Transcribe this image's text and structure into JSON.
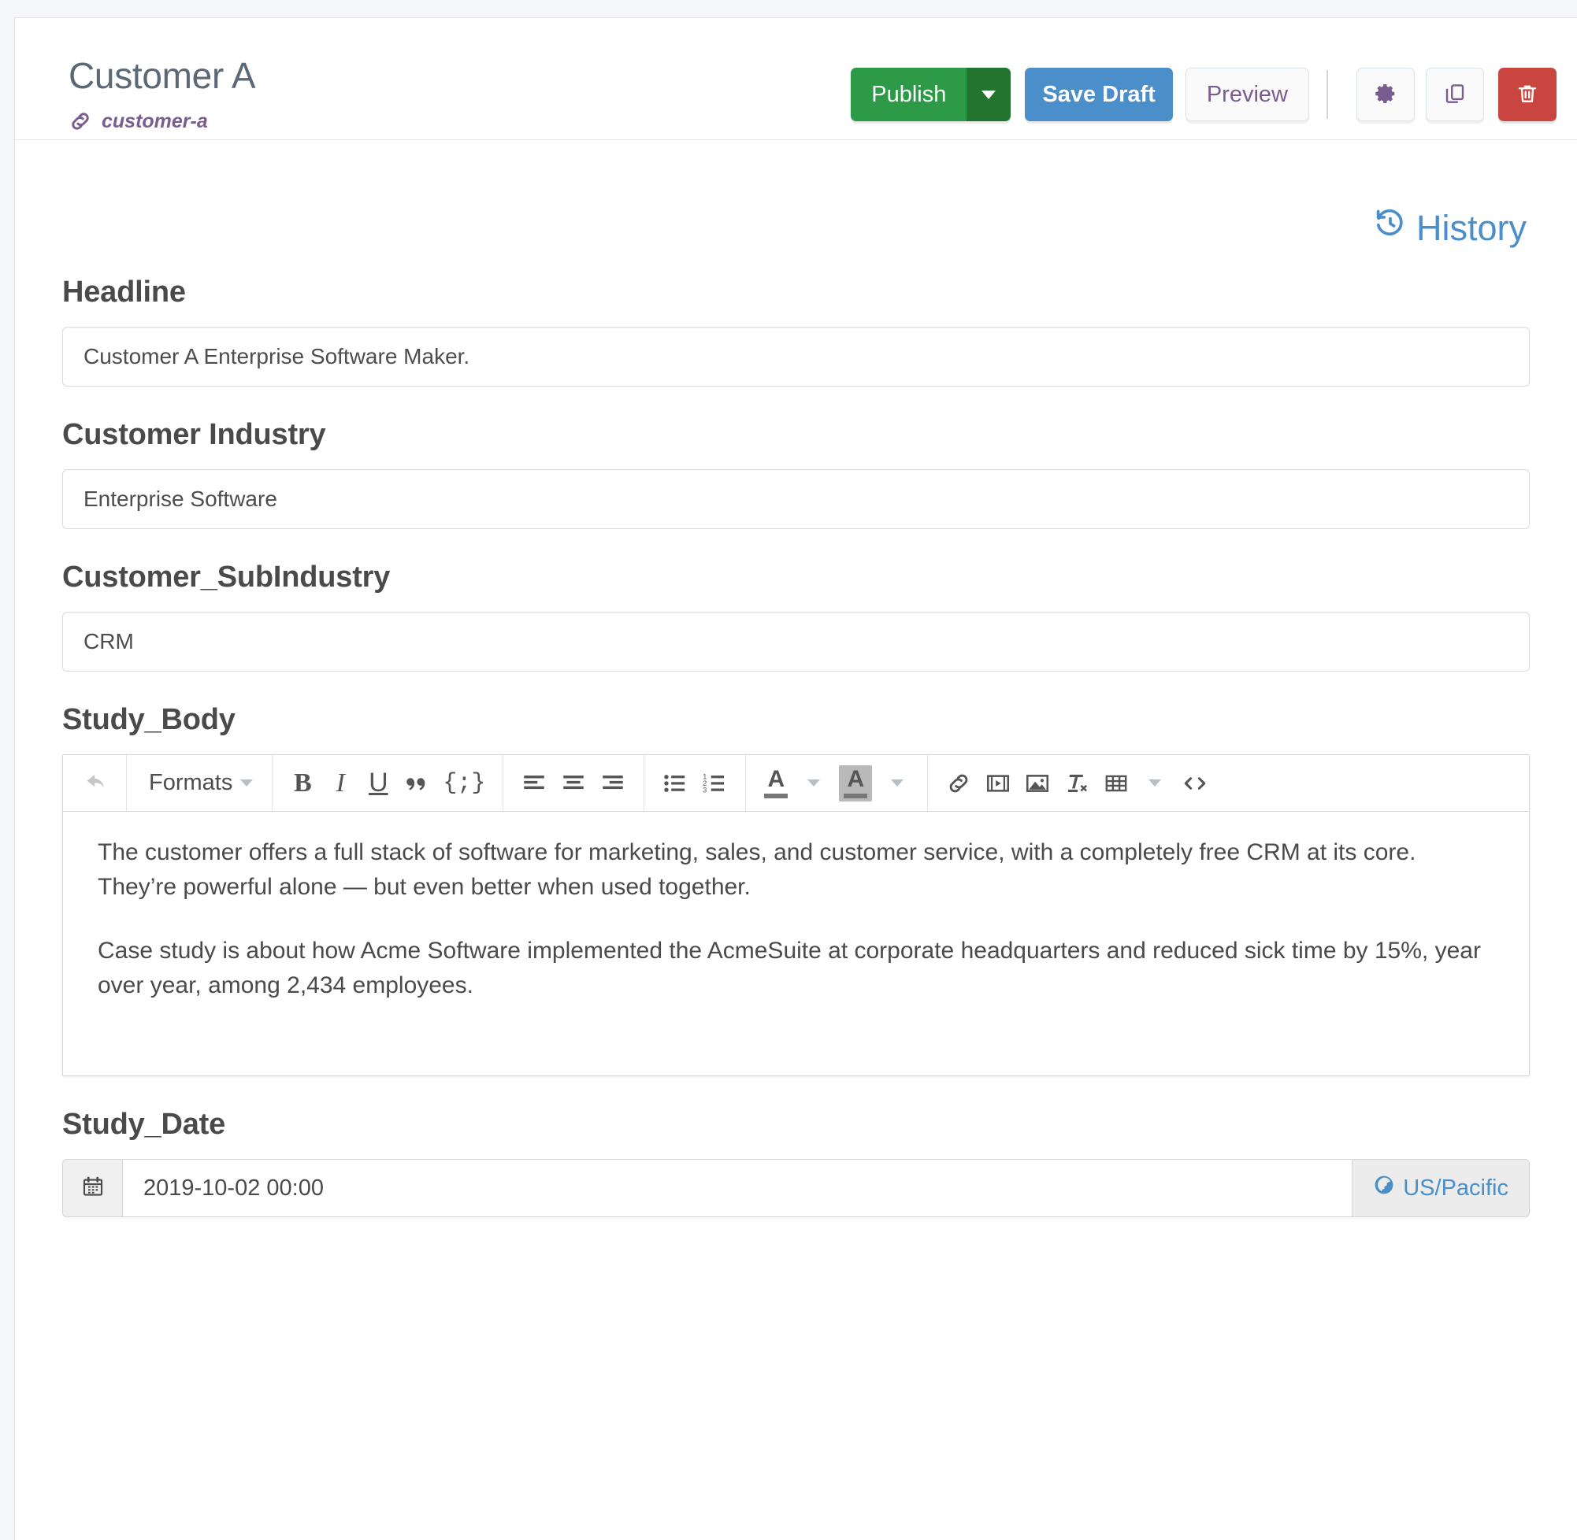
{
  "header": {
    "title": "Customer A",
    "slug": "customer-a",
    "slug_icon": "link-icon",
    "actions": {
      "publish_label": "Publish",
      "publish_caret_icon": "chevron-down-icon",
      "save_draft_label": "Save Draft",
      "preview_label": "Preview",
      "settings_icon": "gear-icon",
      "duplicate_icon": "copy-icon",
      "delete_icon": "trash-icon"
    },
    "colors": {
      "publish": "#2d9a47",
      "publish_caret": "#23742f",
      "save_draft": "#4a8fca",
      "preview_text": "#7a5d8f",
      "delete": "#c9453f",
      "slug": "#7a5d8f",
      "title": "#5b6876",
      "link_blue": "#4a8fca"
    }
  },
  "history": {
    "label": "History",
    "icon": "history-rotate-left-icon"
  },
  "fields": {
    "headline": {
      "label": "Headline",
      "value": "Customer A Enterprise Software Maker.",
      "placeholder": ""
    },
    "customer_industry": {
      "label": "Customer Industry",
      "value": "Enterprise Software",
      "placeholder": ""
    },
    "customer_subindustry": {
      "label": "Customer_SubIndustry",
      "value": "CRM",
      "placeholder": ""
    },
    "study_body": {
      "label": "Study_Body",
      "paragraphs": [
        "The customer offers a full stack of software for marketing, sales, and customer service, with a completely free CRM at its core. They’re powerful alone — but even better when used together.",
        "Case study is about how Acme Software implemented the AcmeSuite at corporate headquarters and reduced sick time by 15%, year over year, among 2,434 employees."
      ]
    },
    "study_date": {
      "label": "Study_Date",
      "value": "2019-10-02 00:00",
      "placeholder": "",
      "calendar_icon": "calendar-icon",
      "timezone_label": "US/Pacific",
      "timezone_icon": "globe-icon"
    }
  },
  "editor_toolbar": {
    "groups": [
      {
        "items": [
          {
            "name": "undo-icon",
            "label": ""
          }
        ]
      },
      {
        "items": [
          {
            "name": "formats-dropdown",
            "label": "Formats"
          }
        ]
      },
      {
        "items": [
          {
            "name": "bold-icon",
            "label": "B"
          },
          {
            "name": "italic-icon",
            "label": "I"
          },
          {
            "name": "underline-icon",
            "label": "U"
          },
          {
            "name": "blockquote-icon",
            "label": "“"
          },
          {
            "name": "code-sample-icon",
            "label": "{;}"
          }
        ]
      },
      {
        "items": [
          {
            "name": "align-left-icon",
            "label": ""
          },
          {
            "name": "align-center-icon",
            "label": ""
          },
          {
            "name": "align-right-icon",
            "label": ""
          }
        ]
      },
      {
        "items": [
          {
            "name": "bullet-list-icon",
            "label": ""
          },
          {
            "name": "numbered-list-icon",
            "label": ""
          }
        ]
      },
      {
        "items": [
          {
            "name": "text-color-icon",
            "label": "A"
          },
          {
            "name": "text-color-caret-icon",
            "label": ""
          },
          {
            "name": "background-color-icon",
            "label": "A"
          },
          {
            "name": "background-color-caret-icon",
            "label": ""
          }
        ]
      },
      {
        "items": [
          {
            "name": "insert-link-icon",
            "label": ""
          },
          {
            "name": "insert-media-icon",
            "label": ""
          },
          {
            "name": "insert-image-icon",
            "label": ""
          },
          {
            "name": "clear-formatting-icon",
            "label": ""
          },
          {
            "name": "table-icon",
            "label": ""
          },
          {
            "name": "source-code-icon",
            "label": "<>"
          }
        ]
      }
    ]
  }
}
